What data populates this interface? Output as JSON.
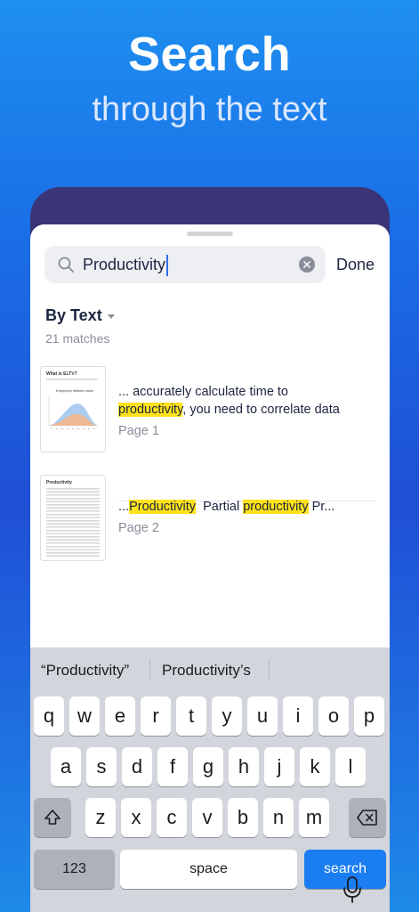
{
  "hero": {
    "title": "Search",
    "subtitle": "through the text"
  },
  "search": {
    "query": "Productivity",
    "done_label": "Done"
  },
  "filter": {
    "label": "By Text",
    "matches": "21 matches"
  },
  "results": [
    {
      "line1": "... accurately calculate time to",
      "highlight": "productivity",
      "after": ", you need to correlate data",
      "page": "Page 1",
      "thumb_title": "What is ELTV?",
      "thumb_chart_title": "Employee lifetime value"
    },
    {
      "prefix": "...",
      "highlight1": "Productivity",
      "middle": "  Partial ",
      "highlight2": "productivity",
      "suffix": " Pr...",
      "page": "Page 2",
      "thumb_title": "Productivity"
    }
  ],
  "keyboard": {
    "suggestions": [
      "“Productivity”",
      "Productivity’s"
    ],
    "row1": [
      "q",
      "w",
      "e",
      "r",
      "t",
      "y",
      "u",
      "i",
      "o",
      "p"
    ],
    "row2": [
      "a",
      "s",
      "d",
      "f",
      "g",
      "h",
      "j",
      "k",
      "l"
    ],
    "row3": [
      "z",
      "x",
      "c",
      "v",
      "b",
      "n",
      "m"
    ],
    "numbers_label": "123",
    "space_label": "space",
    "search_label": "search"
  },
  "colors": {
    "accent": "#1a7ef2",
    "highlight": "#ffe21a",
    "header_bg": "#3a3578"
  }
}
